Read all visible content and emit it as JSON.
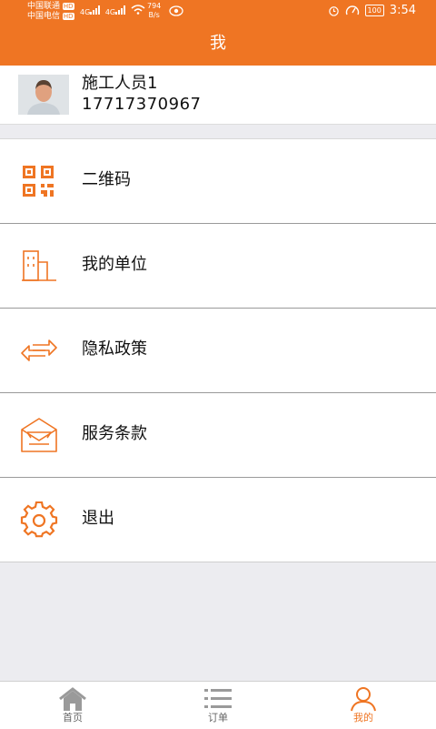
{
  "status_bar": {
    "carrier1": "中国联通",
    "carrier2": "中国电信",
    "hd": "HD",
    "network": "4G",
    "speed_value": "794",
    "speed_unit": "B/s",
    "battery": "100",
    "time": "3:54"
  },
  "header": {
    "title": "我"
  },
  "profile": {
    "name": "施工人员1",
    "phone": "17717370967"
  },
  "menu": [
    {
      "label": "二维码",
      "icon": "qr-code-icon"
    },
    {
      "label": "我的单位",
      "icon": "building-icon"
    },
    {
      "label": "隐私政策",
      "icon": "exchange-arrows-icon"
    },
    {
      "label": "服务条款",
      "icon": "envelope-icon"
    },
    {
      "label": "退出",
      "icon": "gear-icon"
    }
  ],
  "tabs": [
    {
      "label": "首页",
      "icon": "home-icon",
      "active": false
    },
    {
      "label": "订单",
      "icon": "list-icon",
      "active": false
    },
    {
      "label": "我的",
      "icon": "person-icon",
      "active": true
    }
  ],
  "colors": {
    "accent": "#ef7523",
    "background": "#ececf0",
    "inactive": "#9a9a9a"
  }
}
